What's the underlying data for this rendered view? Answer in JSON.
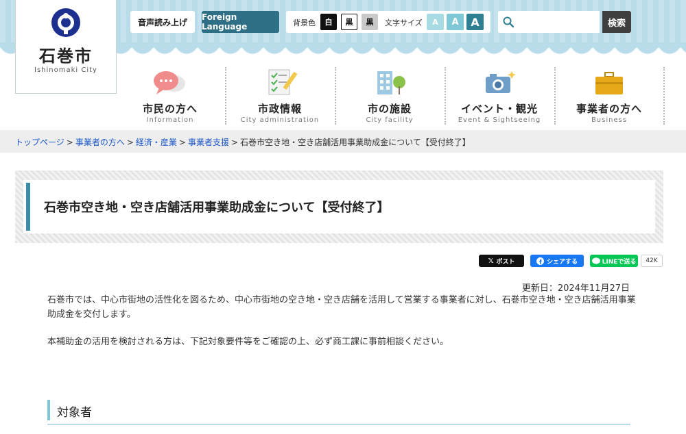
{
  "header": {
    "city_name": "石巻市",
    "city_name_en": "Ishinomaki City",
    "voice_button": "音声読み上げ",
    "foreign_language_button": "Foreign Language",
    "bg_color_label": "背景色",
    "bg_options": [
      "白",
      "黒",
      "黒"
    ],
    "font_size_label": "文字サイズ",
    "font_size_options": [
      "A",
      "A",
      "A"
    ],
    "search_placeholder": "",
    "search_button": "検索",
    "colors": {
      "band": "#b9dcea",
      "foreign_button": "#2f6f86",
      "accent": "#3b8ea7"
    }
  },
  "nav": {
    "items": [
      {
        "label": "市民の方へ",
        "sub": "Information",
        "icon": "speech-bubble-icon"
      },
      {
        "label": "市政情報",
        "sub": "City administration",
        "icon": "document-pen-icon"
      },
      {
        "label": "市の施設",
        "sub": "City facility",
        "icon": "building-tree-icon"
      },
      {
        "label": "イベント・観光",
        "sub": "Event & Sightseeing",
        "icon": "camera-icon"
      },
      {
        "label": "事業者の方へ",
        "sub": "Business",
        "icon": "briefcase-icon"
      }
    ]
  },
  "breadcrumb": {
    "links": [
      "トップページ",
      "事業者の方へ",
      "経済・産業",
      "事業者支援"
    ],
    "current": "石巻市空き地・空き店舗活用事業助成金について【受付終了】",
    "separator": ">"
  },
  "page": {
    "title": "石巻市空き地・空き店舗活用事業助成金について【受付終了】",
    "social": {
      "x_post": "ポスト",
      "fb_share": "シェアする",
      "line_send": "LINEで送る",
      "count": "42K"
    },
    "updated": "更新日：2024年11月27日",
    "paragraphs": [
      "石巻市では、中心市街地の活性化を図るため、中心市街地の空き地・空き店舗を活用して営業する事業者に対し、石巻市空き地・空き店舗活用事業助成金を交付します。",
      "本補助金の活用を検討される方は、下記対象要件等をご確認の上、必ず商工課に事前相談ください。"
    ],
    "section_heading": "対象者"
  }
}
